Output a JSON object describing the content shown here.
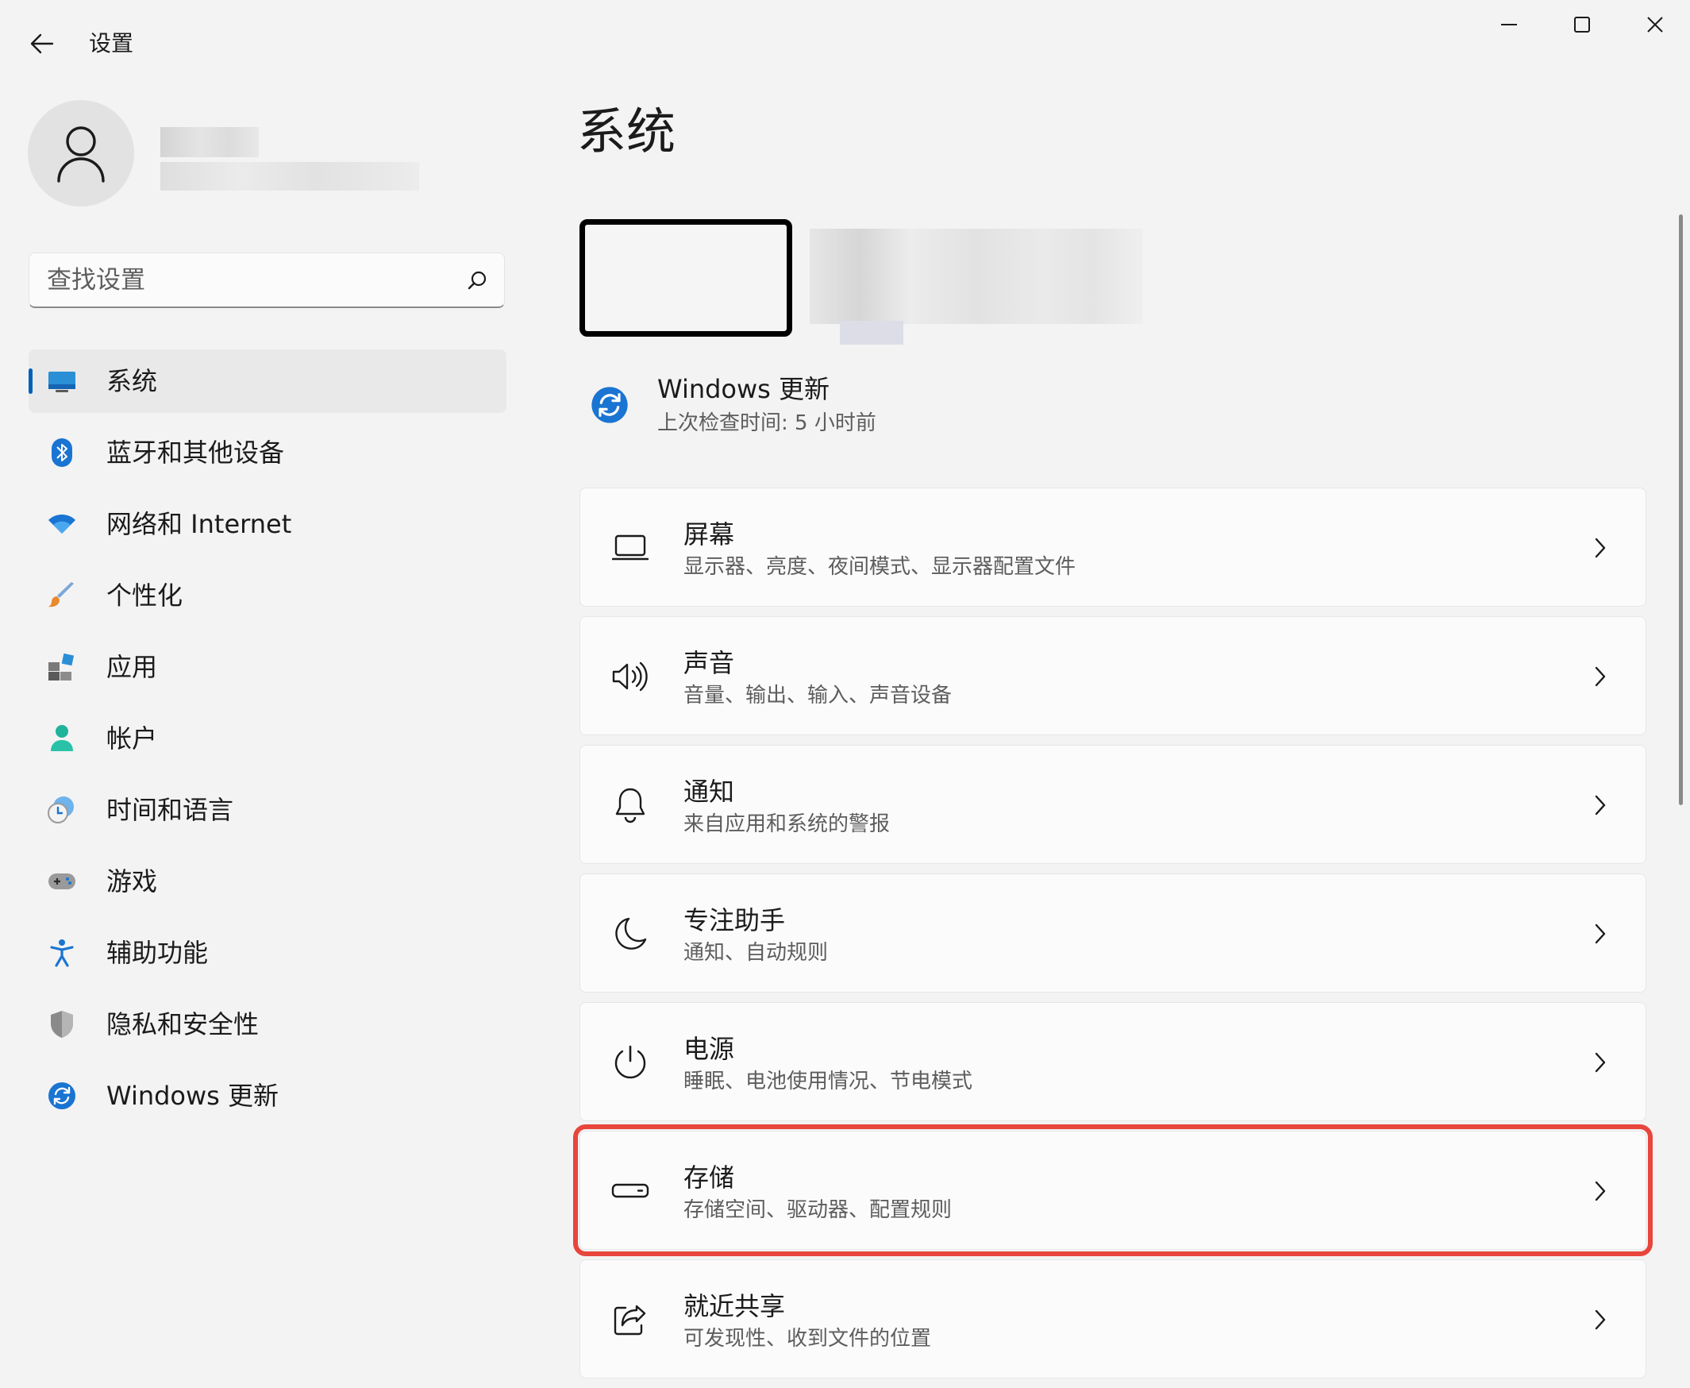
{
  "window": {
    "title": "设置",
    "back_icon": "arrow-left-icon",
    "controls": [
      "minimize-icon",
      "maximize-icon",
      "close-icon"
    ]
  },
  "profile": {
    "avatar_icon": "user-icon"
  },
  "search": {
    "placeholder": "查找设置",
    "icon": "search-icon"
  },
  "nav": {
    "items": [
      {
        "label": "系统",
        "icon": "system-icon",
        "active": true
      },
      {
        "label": "蓝牙和其他设备",
        "icon": "bluetooth-icon"
      },
      {
        "label": "网络和 Internet",
        "icon": "wifi-icon"
      },
      {
        "label": "个性化",
        "icon": "brush-icon"
      },
      {
        "label": "应用",
        "icon": "apps-icon"
      },
      {
        "label": "帐户",
        "icon": "account-icon"
      },
      {
        "label": "时间和语言",
        "icon": "time-language-icon"
      },
      {
        "label": "游戏",
        "icon": "gamepad-icon"
      },
      {
        "label": "辅助功能",
        "icon": "accessibility-icon"
      },
      {
        "label": "隐私和安全性",
        "icon": "shield-icon"
      },
      {
        "label": "Windows 更新",
        "icon": "update-icon"
      }
    ]
  },
  "main": {
    "title": "系统",
    "update": {
      "title": "Windows 更新",
      "subtitle": "上次检查时间: 5 小时前"
    },
    "settings": [
      {
        "title": "屏幕",
        "subtitle": "显示器、亮度、夜间模式、显示器配置文件",
        "icon": "laptop-icon"
      },
      {
        "title": "声音",
        "subtitle": "音量、输出、输入、声音设备",
        "icon": "speaker-icon"
      },
      {
        "title": "通知",
        "subtitle": "来自应用和系统的警报",
        "icon": "bell-icon"
      },
      {
        "title": "专注助手",
        "subtitle": "通知、自动规则",
        "icon": "moon-icon"
      },
      {
        "title": "电源",
        "subtitle": "睡眠、电池使用情况、节电模式",
        "icon": "power-icon"
      },
      {
        "title": "存储",
        "subtitle": "存储空间、驱动器、配置规则",
        "icon": "storage-icon",
        "highlighted": true
      },
      {
        "title": "就近共享",
        "subtitle": "可发现性、收到文件的位置",
        "icon": "share-icon"
      }
    ]
  },
  "colors": {
    "accent": "#005fb8",
    "highlight": "#e8453c",
    "background": "#f3f3f3",
    "card": "#fbfbfb"
  }
}
